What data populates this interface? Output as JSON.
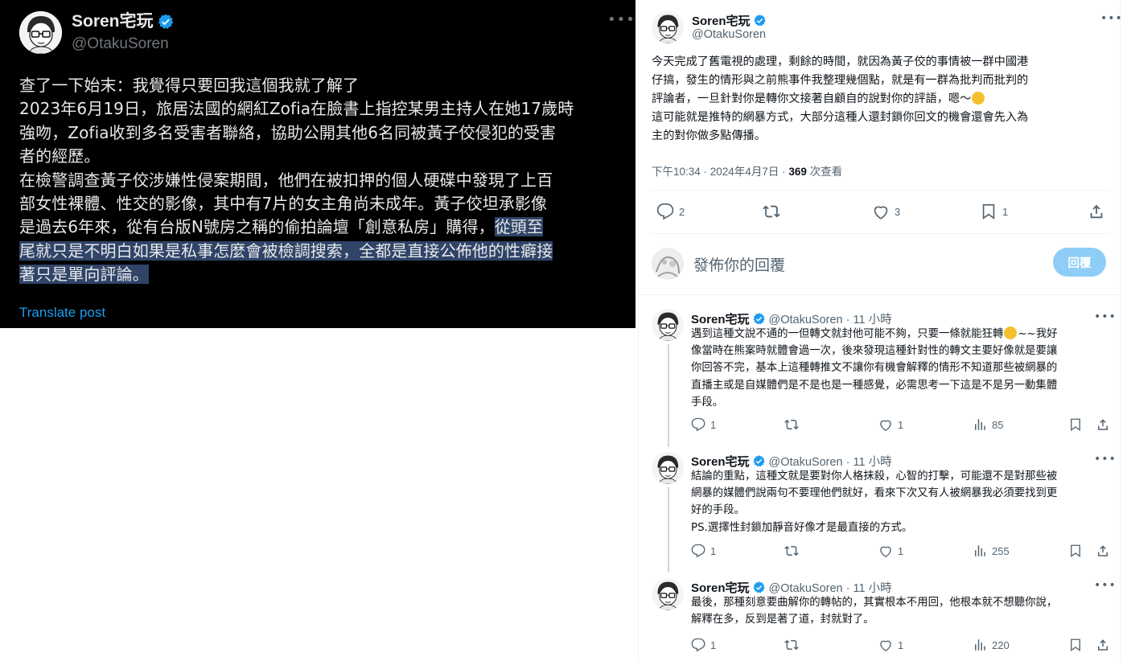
{
  "left_tweet": {
    "name": "Soren宅玩",
    "handle": "@OtakuSoren",
    "lines": [
      "查了一下始末：我覺得只要回我這個我就了解了",
      "2023年6月19日，旅居法國的網紅Zofia在臉書上指控某男主持人在她17歲時",
      "強吻，Zofia收到多名受害者聯絡，協助公開其他6名同被黃子佼侵犯的受害",
      "者的經歷。",
      "在檢警調查黃子佼涉嫌性侵案期間，他們在被扣押的個人硬碟中發現了上百",
      "部女性裸體、性交的影像，其中有7片的女主角尚未成年。黃子佼坦承影像",
      "是過去6年來，從有台版N號房之稱的偷拍論壇「創意私房」購得，"
    ],
    "highlight_start": "從頭至",
    "highlight_lines": [
      "尾就只是不明白如果是私事怎麼會被檢調搜索，全都是直接公佈他的性癖接",
      "著只是單向評論。"
    ],
    "translate": "Translate post"
  },
  "main_tweet": {
    "name": "Soren宅玩",
    "handle": "@OtakuSoren",
    "lines": [
      "今天完成了舊電視的處理，剩餘的時間，就因為黃子佼的事情被一群中國港",
      "仔搞，發生的情形與之前熊事件我整理幾個點，就是有一群為批判而批判的",
      "評論者，一旦針對你是轉你文接著自顧自的說對你的評語，嗯～",
      "這可能就是推特的網暴方式，大部分這種人還封鎖你回文的機會還會先入為",
      "主的對你做多點傳播。"
    ],
    "meta_time": "下午10:34 · 2024年4月7日 · ",
    "meta_views": "369",
    "meta_views_label": " 次查看",
    "replies": "2",
    "likes": "3",
    "bookmarks": "1",
    "reply_placeholder": "發佈你的回覆",
    "reply_button": "回覆"
  },
  "thread": [
    {
      "name": "Soren宅玩",
      "handle": "@OtakuSoren · 11 小時",
      "lines": [
        "遇到這種文說不通的一但轉文就封他可能不夠，只要一條就能狂轉",
        "像當時在熊案時就體會過一次，後來發現這種針對性的轉文主要好像就是要讓",
        "你回答不完，基本上這種轉推文不讓你有機會解釋的情形不知道那些被網暴的",
        "直播主或是自媒體們是不是也是一種感覺，必需思考一下這是不是另一動集體",
        "手段。"
      ],
      "line0_tail": "~~我好",
      "replies": "1",
      "likes": "1",
      "views": "85"
    },
    {
      "name": "Soren宅玩",
      "handle": "@OtakuSoren · 11 小時",
      "lines": [
        "結論的重點，這種文就是要對你人格抹殺，心智的打擊，可能還不是對那些被",
        "網暴的媒體們說兩句不要理他們就好，看來下次又有人被網暴我必須要找到更",
        "好的手段。",
        "PS.選擇性封鎖加靜音好像才是最直接的方式。"
      ],
      "replies": "1",
      "likes": "1",
      "views": "255"
    },
    {
      "name": "Soren宅玩",
      "handle": "@OtakuSoren · 11 小時",
      "lines": [
        "最後，那種刻意要曲解你的轉帖的，其實根本不用回，他根本就不想聽你說，",
        "解釋在多，反到是著了道，封就對了。"
      ],
      "replies": "1",
      "likes": "1",
      "views": "220"
    }
  ],
  "colors": {
    "dark_bg": "#000000",
    "highlight": "#2f4467",
    "link_blue": "#1d9bf0",
    "verified": "#1d9bf0",
    "reply_button": "#8ecdf8"
  },
  "icons": [
    "verified-badge-icon",
    "more-icon",
    "reply-icon",
    "retweet-icon",
    "like-icon",
    "views-icon",
    "bookmark-icon",
    "share-icon"
  ]
}
